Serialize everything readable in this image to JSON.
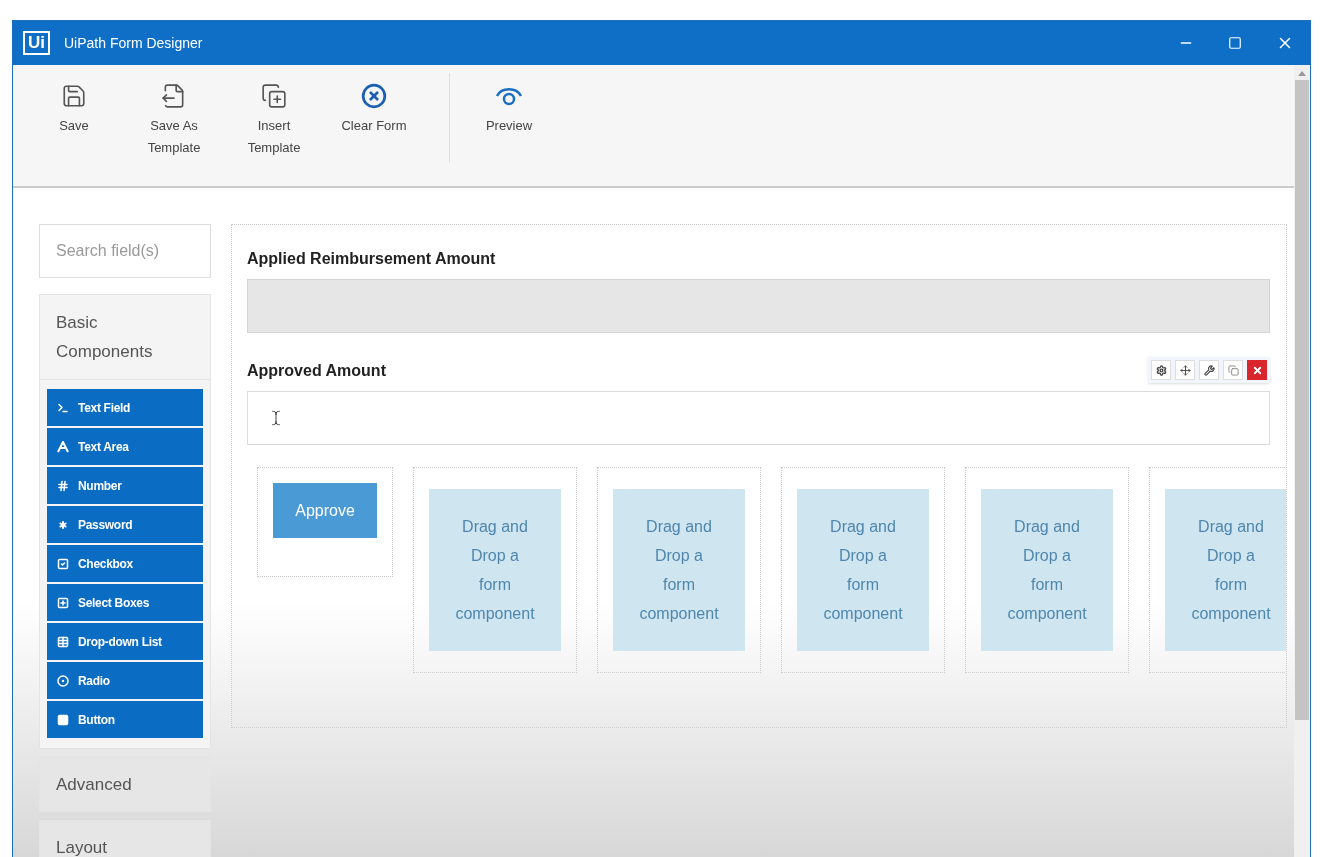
{
  "window": {
    "title": "UiPath Form Designer",
    "logo": "Ui"
  },
  "toolbar": [
    {
      "kind": "save",
      "label": "Save"
    },
    {
      "kind": "save-template",
      "label": "Save As Template"
    },
    {
      "kind": "insert-template",
      "label": "Insert Template"
    },
    {
      "kind": "clear",
      "label": "Clear Form"
    },
    {
      "kind": "preview",
      "label": "Preview"
    }
  ],
  "sidebar": {
    "search": {
      "placeholder": "Search field(s)"
    },
    "groups": [
      {
        "label": "Basic Components",
        "expanded": true,
        "items": [
          {
            "kind": "textfield",
            "label": "Text Field"
          },
          {
            "kind": "textarea",
            "label": "Text Area"
          },
          {
            "kind": "number",
            "label": "Number"
          },
          {
            "kind": "password",
            "label": "Password"
          },
          {
            "kind": "checkbox",
            "label": "Checkbox"
          },
          {
            "kind": "select",
            "label": "Select Boxes"
          },
          {
            "kind": "dropdown",
            "label": "Drop-down List"
          },
          {
            "kind": "radio",
            "label": "Radio"
          },
          {
            "kind": "button",
            "label": "Button"
          }
        ]
      },
      {
        "label": "Advanced",
        "expanded": false
      },
      {
        "label": "Layout",
        "expanded": false
      }
    ]
  },
  "form": {
    "fields": [
      {
        "label": "Applied Reimbursement Amount",
        "disabled": true,
        "selected": false
      },
      {
        "label": "Approved Amount",
        "disabled": false,
        "selected": true
      }
    ],
    "columns": [
      {
        "kind": "button",
        "label": "Approve"
      },
      {
        "kind": "placeholder",
        "label": "Drag and Drop a form component"
      },
      {
        "kind": "placeholder",
        "label": "Drag and Drop a form component"
      },
      {
        "kind": "placeholder",
        "label": "Drag and Drop a form component"
      },
      {
        "kind": "placeholder",
        "label": "Drag and Drop a form component"
      },
      {
        "kind": "placeholder",
        "label": "Drag and Drop a form component"
      }
    ]
  }
}
